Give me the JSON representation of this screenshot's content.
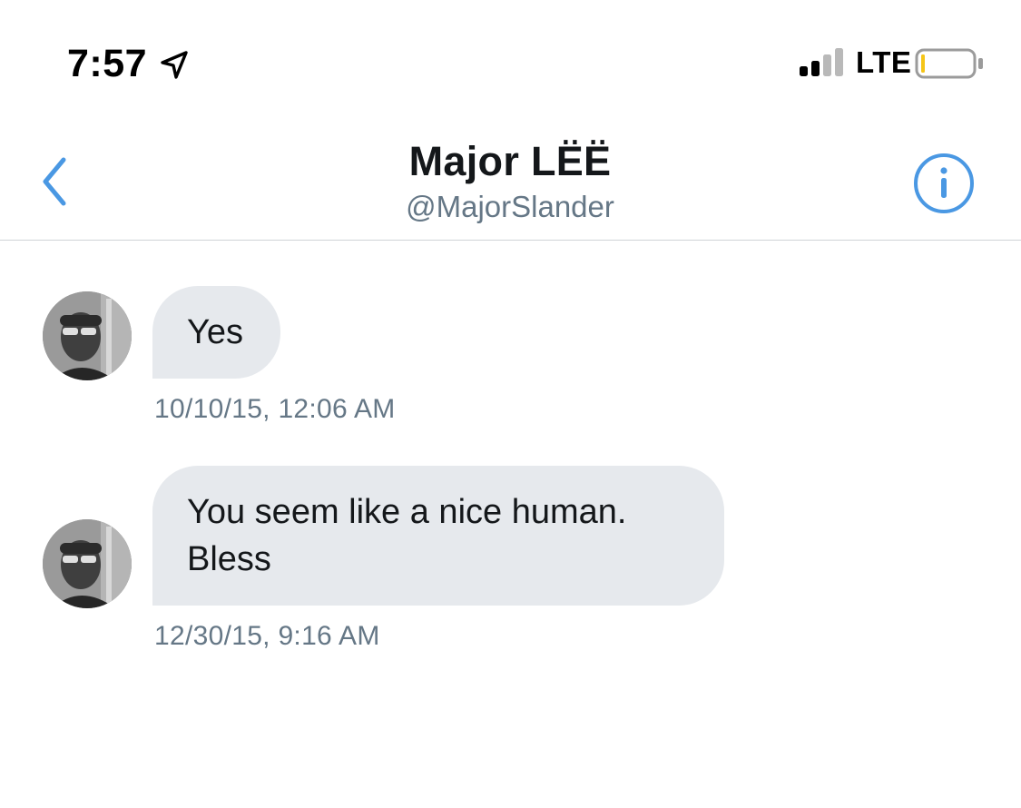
{
  "status_bar": {
    "time": "7:57",
    "carrier": "LTE",
    "icons": [
      "location-arrow-icon",
      "signal-bars-icon",
      "battery-icon"
    ],
    "battery_color": "#f5c518"
  },
  "header": {
    "name": "Major LËË",
    "handle": "@MajorSlander",
    "icons": [
      "chevron-left-icon",
      "info-icon"
    ],
    "accent_color": "#4a98e3"
  },
  "messages": [
    {
      "text": "Yes",
      "timestamp": "10/10/15, 12:06 AM"
    },
    {
      "text_line1": "You seem like a nice human.",
      "text_line2": "Bless",
      "timestamp": "12/30/15, 9:16 AM"
    }
  ],
  "colors": {
    "bubble": "#e6e9ed",
    "secondary_text": "#657786",
    "divider": "#cfd3d7"
  }
}
